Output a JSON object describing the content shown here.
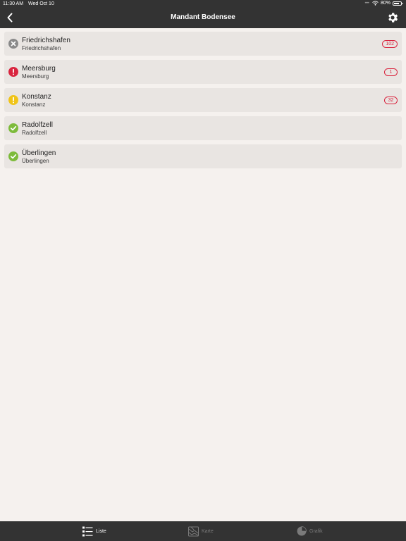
{
  "status_bar": {
    "time": "11:30 AM",
    "date": "Wed Oct 10",
    "battery": "80%",
    "battery_level": 0.8
  },
  "nav": {
    "title": "Mandant Bodensee",
    "back_icon": "chevron-left-icon",
    "settings_icon": "gear-icon"
  },
  "colors": {
    "bar": "#333333",
    "background": "#f5f1ee",
    "row": "#e9e5e2",
    "error": "#d9253f",
    "warning": "#f0c419",
    "ok": "#7dbb3b",
    "inactive": "#8a8a8a"
  },
  "items": [
    {
      "title": "Friedrichshafen",
      "subtitle": "Friedrichshafen",
      "status": "x-circle-icon",
      "badge": "102"
    },
    {
      "title": "Meersburg",
      "subtitle": "Meersburg",
      "status": "error-icon",
      "badge": "1"
    },
    {
      "title": "Konstanz",
      "subtitle": "Konstanz",
      "status": "warning-icon",
      "badge": "32"
    },
    {
      "title": "Radolfzell",
      "subtitle": "Radolfzell",
      "status": "check-circle-icon",
      "badge": ""
    },
    {
      "title": "Überlingen",
      "subtitle": "Überlingen",
      "status": "check-circle-icon",
      "badge": ""
    }
  ],
  "tabs": [
    {
      "label": "Liste",
      "icon": "list-icon",
      "active": true
    },
    {
      "label": "Karte",
      "icon": "map-icon",
      "active": false
    },
    {
      "label": "Grafik",
      "icon": "pie-chart-icon",
      "active": false
    }
  ]
}
